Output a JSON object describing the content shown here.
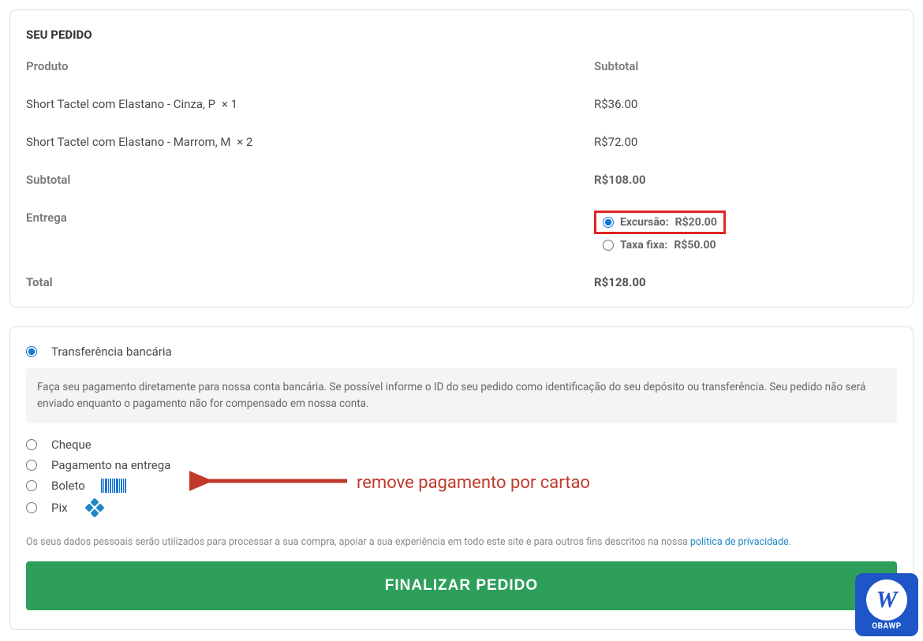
{
  "order": {
    "title": "SEU PEDIDO",
    "product_header": "Produto",
    "subtotal_header": "Subtotal",
    "items": [
      {
        "name": "Short Tactel com Elastano - Cinza, P",
        "qty": "× 1",
        "price": "R$36.00"
      },
      {
        "name": "Short Tactel com Elastano - Marrom, M",
        "qty": "× 2",
        "price": "R$72.00"
      }
    ],
    "subtotal_label": "Subtotal",
    "subtotal_value": "R$108.00",
    "shipping_label": "Entrega",
    "shipping_options": [
      {
        "label": "Excursão:",
        "price": "R$20.00",
        "selected": true,
        "highlight": true
      },
      {
        "label": "Taxa fixa:",
        "price": "R$50.00",
        "selected": false,
        "highlight": false
      }
    ],
    "total_label": "Total",
    "total_value": "R$128.00"
  },
  "payment": {
    "methods": [
      {
        "label": "Transferência bancária",
        "selected": true,
        "icon": null
      },
      {
        "label": "Cheque",
        "selected": false,
        "icon": null
      },
      {
        "label": "Pagamento na entrega",
        "selected": false,
        "icon": null
      },
      {
        "label": "Boleto",
        "selected": false,
        "icon": "boleto"
      },
      {
        "label": "Pix",
        "selected": false,
        "icon": "pix"
      }
    ],
    "bank_desc": "Faça seu pagamento diretamente para nossa conta bancária. Se possível informe o ID do seu pedido como identificação do seu depósito ou transferência. Seu pedido não será enviado enquanto o pagamento não for compensado em nossa conta.",
    "privacy_text": "Os seus dados pessoais serão utilizados para processar a sua compra, apoiar a sua experiência em todo este site e para outros fins descritos na nossa ",
    "privacy_link": "política de privacidade",
    "submit_label": "FINALIZAR PEDIDO"
  },
  "annotation": {
    "text": "remove pagamento por cartao"
  },
  "badge": {
    "letter": "W",
    "label": "OBAWP"
  }
}
